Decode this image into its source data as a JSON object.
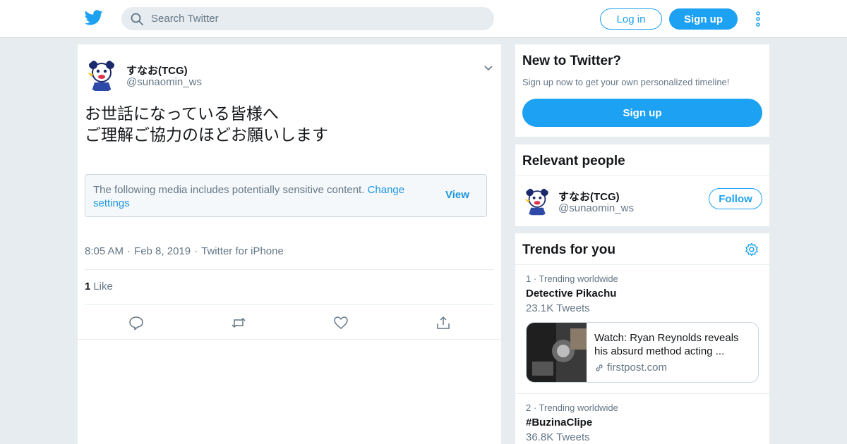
{
  "topbar": {
    "search_placeholder": "Search Twitter",
    "login_label": "Log in",
    "signup_label": "Sign up"
  },
  "tweet": {
    "author_name": "すなお(TCG)",
    "author_handle": "@sunaomin_ws",
    "text": "お世話になっている皆様へ\nご理解ご協力のほどお願いします",
    "sensitive_message": "The following media includes potentially sensitive content.",
    "sensitive_link": "Change settings",
    "view_label": "View",
    "time": "8:05 AM",
    "date": "Feb 8, 2019",
    "source": "Twitter for iPhone",
    "like_count": "1",
    "like_label": "Like"
  },
  "new_to_twitter": {
    "title": "New to Twitter?",
    "subtitle": "Sign up now to get your own personalized timeline!",
    "signup_label": "Sign up"
  },
  "relevant_people": {
    "title": "Relevant people",
    "name": "すなお(TCG)",
    "handle": "@sunaomin_ws",
    "follow_label": "Follow"
  },
  "trends": {
    "title": "Trends for you",
    "items": [
      {
        "meta": "1 · Trending worldwide",
        "name": "Detective Pikachu",
        "count": "23.1K Tweets",
        "card_text": "Watch: Ryan Reynolds reveals his absurd method acting ...",
        "card_source": "firstpost.com"
      },
      {
        "meta": "2 · Trending worldwide",
        "name": "#BuzinaClipe",
        "count": "36.8K Tweets"
      }
    ]
  },
  "colors": {
    "accent": "#1da1f2",
    "background": "#e6ecf0",
    "secondary_text": "#657786"
  }
}
